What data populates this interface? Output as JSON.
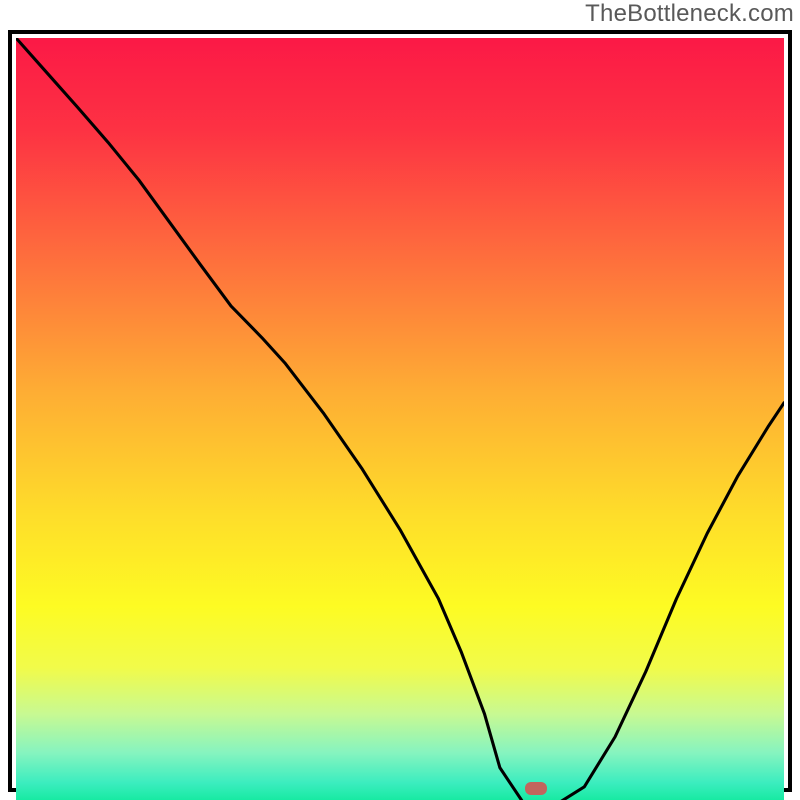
{
  "watermark": "TheBottleneck.com",
  "colors": {
    "gradient_stops": [
      {
        "pct": 0,
        "color": "#fb1946"
      },
      {
        "pct": 12,
        "color": "#fd3243"
      },
      {
        "pct": 28,
        "color": "#fe6c3d"
      },
      {
        "pct": 46,
        "color": "#fead34"
      },
      {
        "pct": 62,
        "color": "#fedd2a"
      },
      {
        "pct": 74,
        "color": "#fdfb23"
      },
      {
        "pct": 82,
        "color": "#f1fb4a"
      },
      {
        "pct": 88,
        "color": "#c8f992"
      },
      {
        "pct": 93,
        "color": "#87f4bf"
      },
      {
        "pct": 97,
        "color": "#3bedbf"
      },
      {
        "pct": 100,
        "color": "#0be998"
      }
    ],
    "curve": "#000000",
    "marker_fill": "#c1655d",
    "border": "#000000"
  },
  "chart_data": {
    "type": "line",
    "title": "",
    "xlabel": "",
    "ylabel": "",
    "xlim": [
      0,
      1
    ],
    "ylim": [
      0,
      1
    ],
    "y_orientation": "0-at-bottom",
    "x": [
      0.0,
      0.04,
      0.08,
      0.12,
      0.16,
      0.2,
      0.24,
      0.28,
      0.32,
      0.35,
      0.4,
      0.45,
      0.5,
      0.55,
      0.58,
      0.61,
      0.63,
      0.66,
      0.7,
      0.74,
      0.78,
      0.82,
      0.86,
      0.9,
      0.94,
      0.98,
      1.0
    ],
    "values": [
      1.0,
      0.955,
      0.91,
      0.864,
      0.815,
      0.76,
      0.705,
      0.651,
      0.61,
      0.577,
      0.512,
      0.44,
      0.36,
      0.27,
      0.2,
      0.12,
      0.05,
      0.005,
      0.0,
      0.025,
      0.09,
      0.175,
      0.27,
      0.355,
      0.43,
      0.495,
      0.525
    ],
    "marker": {
      "x": 0.67,
      "y": 0.005
    }
  }
}
